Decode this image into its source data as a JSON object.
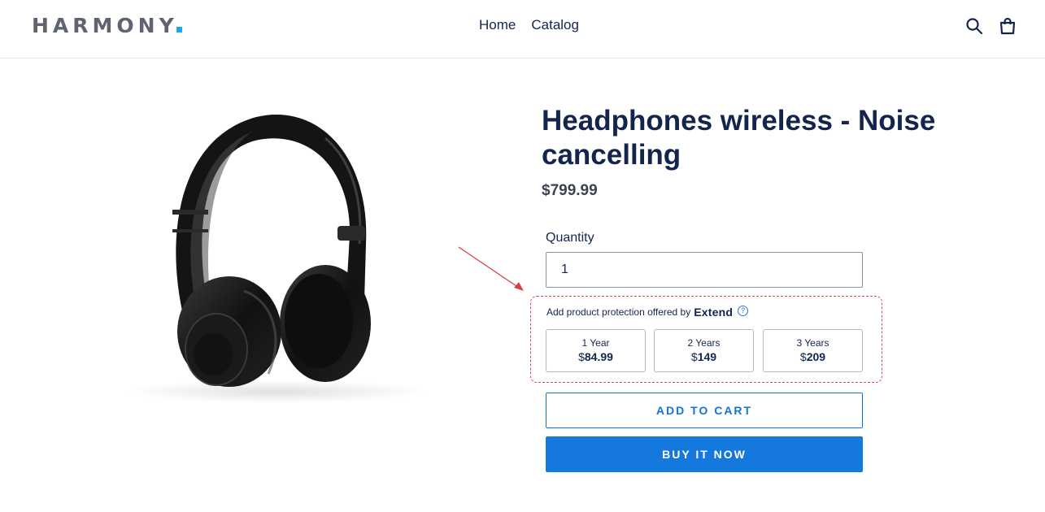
{
  "header": {
    "logo": "HARMONY",
    "nav": [
      "Home",
      "Catalog"
    ],
    "icons": {
      "search": "search-icon",
      "cart": "cart-icon"
    }
  },
  "product": {
    "image": "headphones-product-image",
    "title": "Headphones wireless - Noise cancelling",
    "price": "$799.99",
    "quantity_label": "Quantity",
    "quantity_value": "1"
  },
  "protection": {
    "header": "Add product protection offered by",
    "brand": "Extend",
    "help": "?",
    "plans": [
      {
        "term": "1 Year",
        "currency": "$",
        "price": "84.99"
      },
      {
        "term": "2 Years",
        "currency": "$",
        "price": "149"
      },
      {
        "term": "3 Years",
        "currency": "$",
        "price": "209"
      }
    ]
  },
  "buttons": {
    "add_to_cart": "ADD TO CART",
    "buy_now": "BUY IT NOW"
  },
  "colors": {
    "navy": "#14254d",
    "accent_blue": "#1478dc",
    "logo_dot": "#1aa9e8",
    "annotation_red": "#e2474f"
  }
}
